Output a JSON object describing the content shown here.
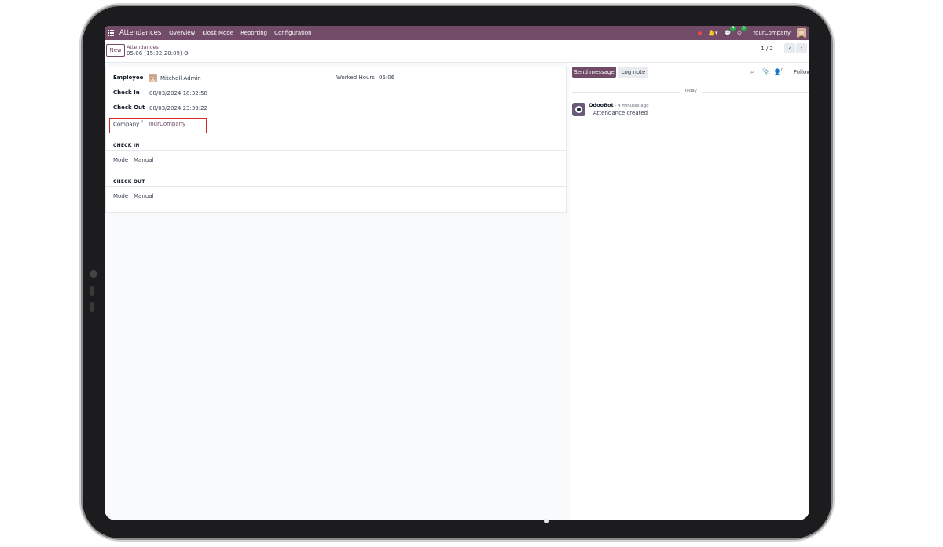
{
  "navbar": {
    "app_name": "Attendances",
    "menu": [
      "Overview",
      "Kiosk Mode",
      "Reporting",
      "Configuration"
    ],
    "messages_count": "4",
    "activities_count": "6",
    "company": "YourCompany"
  },
  "control": {
    "new_label": "New",
    "breadcrumb_parent": "Attendances",
    "breadcrumb_current": "05:06 (15:02-20:09)",
    "pager": "1 / 2"
  },
  "form": {
    "employee_label": "Employee",
    "employee_value": "Mitchell Admin",
    "check_in_label": "Check In",
    "check_in_value": "08/03/2024 18:32:58",
    "check_out_label": "Check Out",
    "check_out_value": "08/03/2024 23:39:22",
    "company_label": "Company",
    "company_help": "?",
    "company_value": "YourCompany",
    "worked_hours_label": "Worked Hours",
    "worked_hours_value": "05:06",
    "check_in_section": "CHECK IN",
    "check_in_mode_label": "Mode",
    "check_in_mode_value": "Manual",
    "check_out_section": "CHECK OUT",
    "check_out_mode_label": "Mode",
    "check_out_mode_value": "Manual"
  },
  "chatter": {
    "send_message": "Send message",
    "log_note": "Log note",
    "followers_count": "0",
    "follow": "Follow",
    "date_separator": "Today",
    "author": "OdooBot",
    "time": " - 4 minutes ago",
    "body": "Attendance created"
  },
  "colors": {
    "brand": "#714b67",
    "highlight": "#d62828"
  }
}
